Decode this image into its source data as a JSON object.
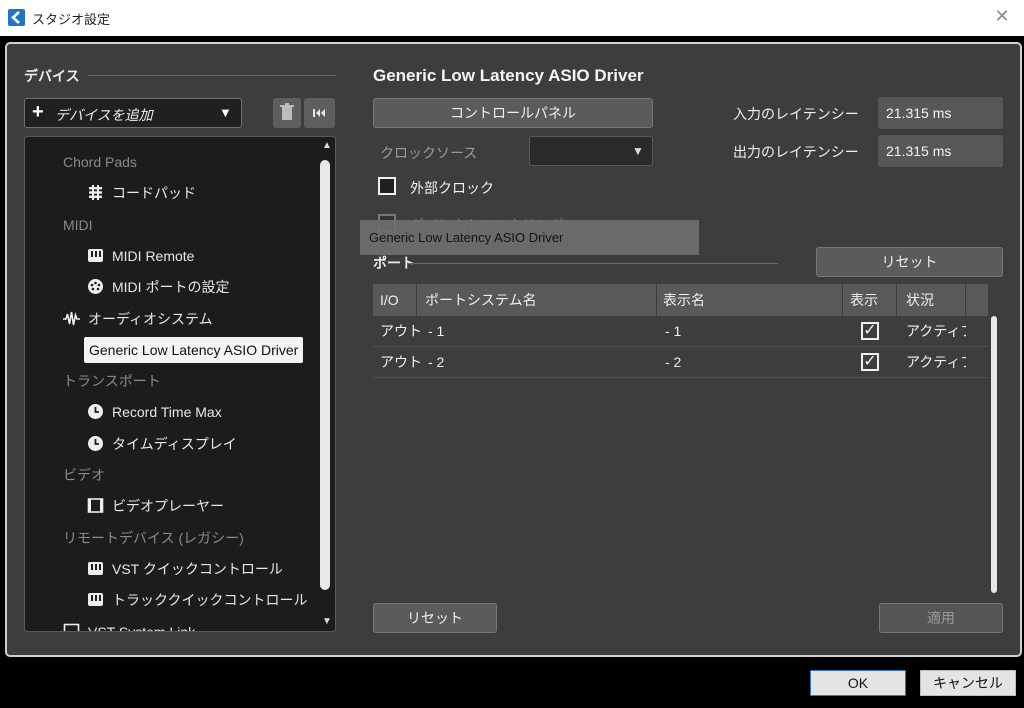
{
  "window": {
    "title": "スタジオ設定",
    "close_glyph": "✕"
  },
  "sidebar": {
    "section_title": "デバイス",
    "add_device": {
      "plus": "+",
      "label": "デバイスを追加",
      "arrow": "▼"
    },
    "toolbar": {
      "delete_glyph": "🗑",
      "reset_glyph": "⏮"
    },
    "tree": [
      {
        "type": "category",
        "label": "Chord Pads"
      },
      {
        "type": "item",
        "icon": "chord-pads-icon",
        "label": "コードパッド"
      },
      {
        "type": "category",
        "label": "MIDI"
      },
      {
        "type": "item",
        "icon": "midi-keyboard-icon",
        "label": "MIDI Remote"
      },
      {
        "type": "item",
        "icon": "midi-port-icon",
        "label": "MIDI ポートの設定"
      },
      {
        "type": "item",
        "icon": "audio-wave-icon",
        "label": "オーディオシステム",
        "level": 0
      },
      {
        "type": "item",
        "icon": "",
        "label": "Generic Low Latency ASIO Driver",
        "selected": true
      },
      {
        "type": "category",
        "label": "トランスポート"
      },
      {
        "type": "item",
        "icon": "clock-icon",
        "label": "Record Time Max"
      },
      {
        "type": "item",
        "icon": "clock-icon",
        "label": "タイムディスプレイ"
      },
      {
        "type": "category",
        "label": "ビデオ"
      },
      {
        "type": "item",
        "icon": "video-player-icon",
        "label": "ビデオプレーヤー"
      },
      {
        "type": "category",
        "label": "リモートデバイス (レガシー)"
      },
      {
        "type": "item",
        "icon": "midi-keyboard-icon",
        "label": "VST クイックコントロール"
      },
      {
        "type": "item",
        "icon": "midi-keyboard-icon",
        "label": "トラッククイックコントロール"
      },
      {
        "type": "item",
        "icon": "checkbox-icon",
        "label": "VST System Link",
        "level": 0
      }
    ],
    "reset_button": "リセット"
  },
  "main": {
    "title": "Generic Low Latency ASIO Driver",
    "control_panel_button": "コントロールパネル",
    "clock_source_label": "クロックソース",
    "clock_source_value": "",
    "clock_source_arrow": "▼",
    "input_latency_label": "入力のレイテンシー",
    "input_latency_value": "21.315 ms",
    "output_latency_label": "出力のレイテンシー",
    "output_latency_value": "21.315 ms",
    "external_clock_label": "外部クロック",
    "direct_monitoring_label": "ダイレクトモニタリング",
    "tooltip": "Generic Low Latency ASIO Driver",
    "ports_section_title": "ポート",
    "ports_reset_button": "リセット",
    "table": {
      "headers": [
        "I/O",
        "ポートシステム名",
        "表示名",
        "表示",
        "状況"
      ],
      "rows": [
        {
          "io": "アウト",
          "system_name": "- 1",
          "display_name": "- 1",
          "visible": true,
          "status": "アクティブ"
        },
        {
          "io": "アウト",
          "system_name": "- 2",
          "display_name": "- 2",
          "visible": true,
          "status": "アクティブ"
        }
      ]
    },
    "apply_button": "適用"
  },
  "dialog": {
    "ok": "OK",
    "cancel": "キャンセル"
  }
}
